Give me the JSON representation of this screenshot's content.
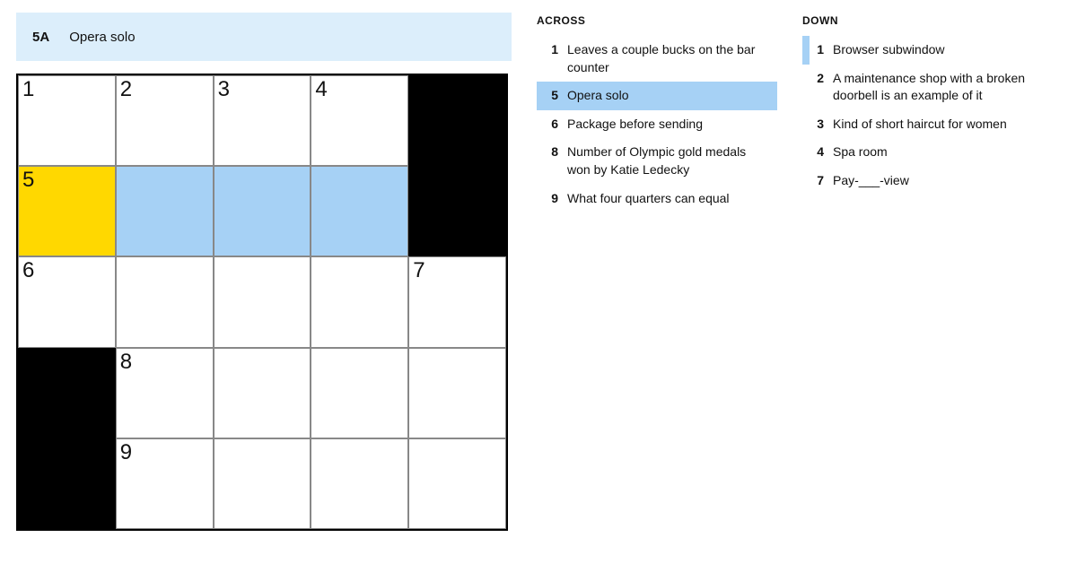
{
  "clue_bar": {
    "number": "5A",
    "text": "Opera solo"
  },
  "grid": {
    "rows": 5,
    "cols": 5,
    "cells": [
      [
        {
          "n": "1"
        },
        {
          "n": "2"
        },
        {
          "n": "3"
        },
        {
          "n": "4"
        },
        {
          "black": true
        }
      ],
      [
        {
          "n": "5",
          "focus": true
        },
        {
          "hl": true
        },
        {
          "hl": true
        },
        {
          "hl": true
        },
        {
          "black": true
        }
      ],
      [
        {
          "n": "6"
        },
        {},
        {},
        {},
        {
          "n": "7"
        }
      ],
      [
        {
          "black": true
        },
        {
          "n": "8"
        },
        {},
        {},
        {}
      ],
      [
        {
          "black": true
        },
        {
          "n": "9"
        },
        {},
        {},
        {}
      ]
    ]
  },
  "clues": {
    "across_title": "ACROSS",
    "down_title": "DOWN",
    "across": [
      {
        "num": "1",
        "text": "Leaves a couple bucks on the bar counter"
      },
      {
        "num": "5",
        "text": "Opera solo",
        "selected": true
      },
      {
        "num": "6",
        "text": "Package before sending"
      },
      {
        "num": "8",
        "text": "Number of Olympic gold medals won by Katie Ledecky"
      },
      {
        "num": "9",
        "text": "What four quarters can equal"
      }
    ],
    "down": [
      {
        "num": "1",
        "text": "Browser subwindow",
        "related": true
      },
      {
        "num": "2",
        "text": "A maintenance shop with a broken doorbell is an example of it"
      },
      {
        "num": "3",
        "text": "Kind of short haircut for women"
      },
      {
        "num": "4",
        "text": "Spa room"
      },
      {
        "num": "7",
        "text": "Pay-___-view"
      }
    ]
  }
}
